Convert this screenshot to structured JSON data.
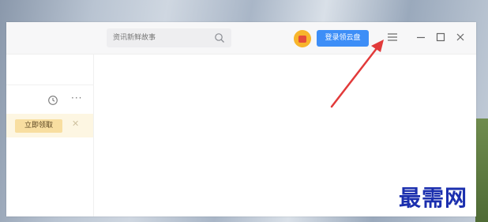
{
  "search": {
    "placeholder": "资讯新鲜故事"
  },
  "header": {
    "login_label": "登录领云盘"
  },
  "sidebar": {
    "claim_label": "立即领取"
  },
  "watermark": {
    "text": "最需网"
  },
  "colors": {
    "accent": "#3d8ef7",
    "annotation_arrow": "#e23a3a",
    "watermark": "#1b2fae",
    "notice_bg": "#fdf6e2"
  },
  "icons": [
    "search-icon",
    "avatar-icon",
    "menu-icon",
    "minimize-icon",
    "maximize-icon",
    "close-icon",
    "clock-icon",
    "more-icon",
    "close-notice-icon"
  ]
}
